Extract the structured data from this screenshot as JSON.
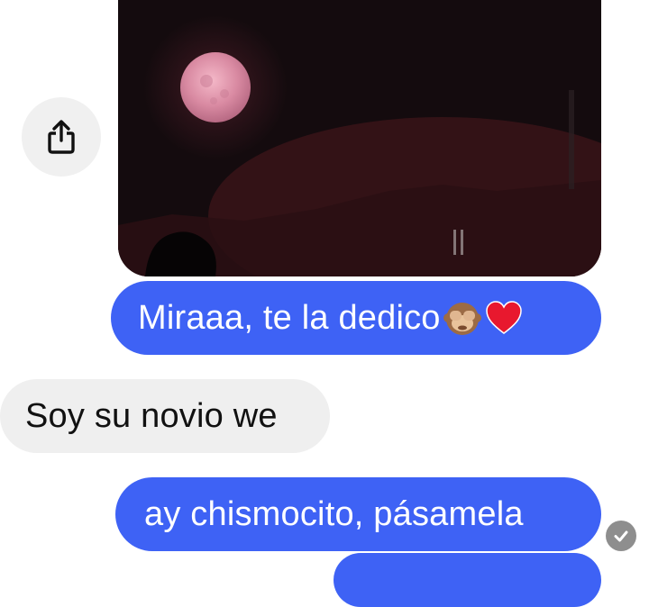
{
  "messages": [
    {
      "id": "photo",
      "direction": "sent",
      "type": "image",
      "image_icon": "pink-full-moon-night-photo"
    },
    {
      "id": "m1",
      "direction": "sent",
      "text": "Miraaa, te la dedico",
      "emojis": [
        "see-no-evil-monkey-emoji",
        "red-heart-emoji"
      ]
    },
    {
      "id": "m2",
      "direction": "received",
      "text": "Soy su novio we"
    },
    {
      "id": "m3",
      "direction": "sent",
      "text": "ay chismocito, pásamela"
    }
  ],
  "actions": {
    "share_icon": "share-icon"
  },
  "status": {
    "read_icon": "checkmark-circle-icon"
  },
  "colors": {
    "sent_bubble": "#3e62f5",
    "received_bubble": "#efefef",
    "background": "#ffffff"
  }
}
